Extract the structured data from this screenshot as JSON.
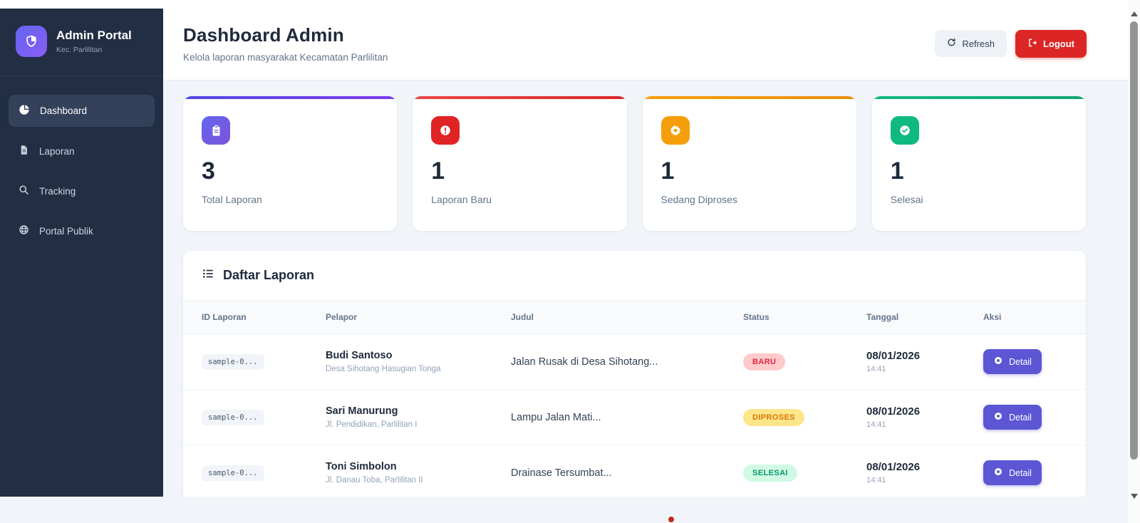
{
  "sidebar": {
    "brand_title": "Admin Portal",
    "brand_subtitle": "Kec. Parlilitan",
    "items": [
      {
        "label": "Dashboard",
        "icon": "pie-chart-icon",
        "active": true
      },
      {
        "label": "Laporan",
        "icon": "document-icon",
        "active": false
      },
      {
        "label": "Tracking",
        "icon": "search-icon",
        "active": false
      },
      {
        "label": "Portal Publik",
        "icon": "globe-icon",
        "active": false
      }
    ]
  },
  "header": {
    "title": "Dashboard Admin",
    "subtitle": "Kelola laporan masyarakat Kecamatan Parlilitan",
    "refresh_label": "Refresh",
    "logout_label": "Logout"
  },
  "stats": [
    {
      "value": "3",
      "label": "Total Laporan",
      "icon": "clipboard-icon",
      "accent_color": "#6d4ae0"
    },
    {
      "value": "1",
      "label": "Laporan Baru",
      "icon": "alert-circle-icon",
      "accent_color": "#dc2626"
    },
    {
      "value": "1",
      "label": "Sedang Diproses",
      "icon": "gear-icon",
      "accent_color": "#f59e0b"
    },
    {
      "value": "1",
      "label": "Selesai",
      "icon": "check-circle-icon",
      "accent_color": "#10b981"
    }
  ],
  "table": {
    "title": "Daftar Laporan",
    "columns": [
      "ID Laporan",
      "Pelapor",
      "Judul",
      "Status",
      "Tanggal",
      "Aksi"
    ],
    "detail_label": "Detail",
    "rows": [
      {
        "id": "sample-0...",
        "reporter": "Budi Santoso",
        "address": "Desa Sihotang Hasugian Tonga",
        "judul": "Jalan Rusak di Desa Sihotang...",
        "status": "BARU",
        "date": "08/01/2026",
        "time": "14:41"
      },
      {
        "id": "sample-0...",
        "reporter": "Sari Manurung",
        "address": "Jl. Pendidikan, Parlilitan I",
        "judul": "Lampu Jalan Mati...",
        "status": "DIPROSES",
        "date": "08/01/2026",
        "time": "14:41"
      },
      {
        "id": "sample-0...",
        "reporter": "Toni Simbolon",
        "address": "Jl. Danau Toba, Parlilitan II",
        "judul": "Drainase Tersumbat...",
        "status": "SELESAI",
        "date": "08/01/2026",
        "time": "14:41"
      }
    ]
  },
  "status_colors": {
    "BARU": {
      "bg": "#fecaca",
      "text": "#e02443"
    },
    "DIPROSES": {
      "bg": "#fde68a",
      "text": "#d97706"
    },
    "SELESAI": {
      "bg": "#d1fae5",
      "text": "#059669"
    }
  },
  "brand_colors": {
    "sidebar_bg": "#222e43",
    "accent_purple": "#6366f1",
    "logout_red": "#dc2626",
    "detail_button": "#5c56d4",
    "page_bg": "#f1f5f9"
  }
}
